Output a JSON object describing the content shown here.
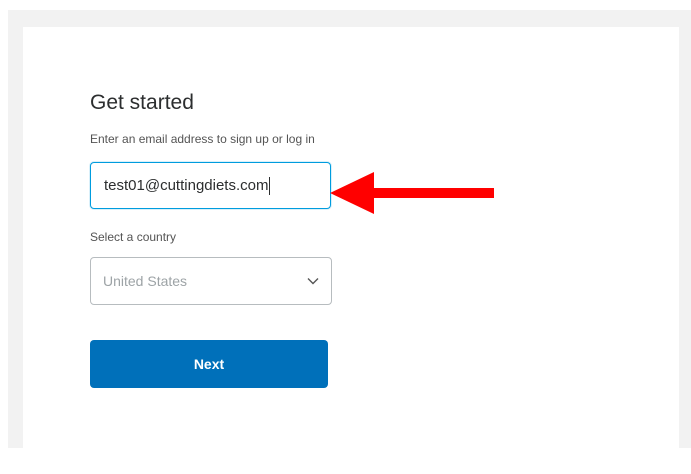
{
  "signup": {
    "title": "Get started",
    "subtitle": "Enter an email address to sign up or log in",
    "email": {
      "value": "test01@cuttingdiets.com"
    },
    "country": {
      "label": "Select a country",
      "selected": "United States"
    },
    "next_label": "Next"
  },
  "colors": {
    "primary_button": "#0070ba",
    "focus_border": "#009cde",
    "annotation_arrow": "#ff0000"
  },
  "icons": {
    "dropdown": "chevron-down-icon",
    "annotation": "red-arrow-icon"
  }
}
